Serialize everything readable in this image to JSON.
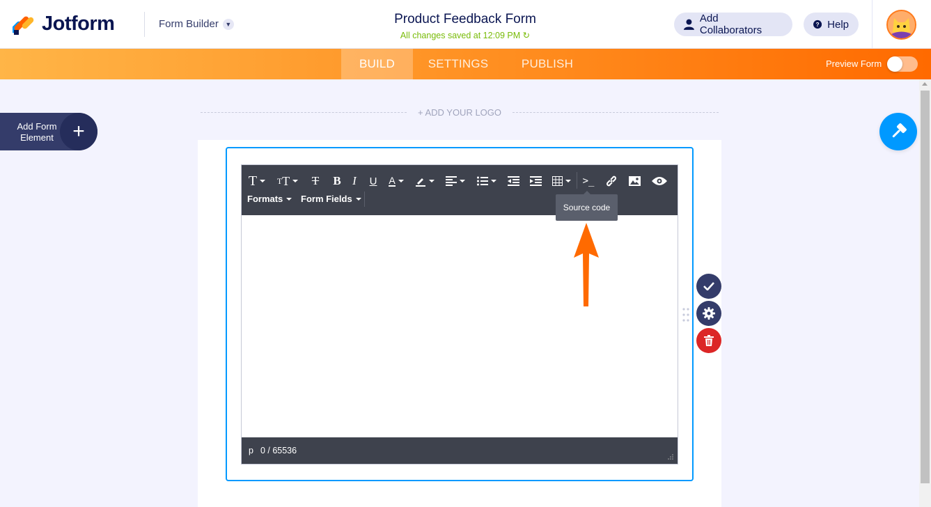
{
  "header": {
    "brand": "Jotform",
    "builder_label": "Form Builder",
    "form_title": "Product Feedback Form",
    "saved_status": "All changes saved at 12:09 PM",
    "collaborators_label": "Add Collaborators",
    "help_label": "Help"
  },
  "nav": {
    "tabs": [
      {
        "label": "BUILD",
        "active": true
      },
      {
        "label": "SETTINGS",
        "active": false
      },
      {
        "label": "PUBLISH",
        "active": false
      }
    ],
    "preview_label": "Preview Form",
    "preview_on": false
  },
  "sidebar": {
    "add_element_label": "Add Form Element"
  },
  "canvas": {
    "add_logo_label": "+ ADD YOUR LOGO"
  },
  "editor": {
    "toolbar_row2": [
      "Formats",
      "Form Fields"
    ],
    "tooltip": "Source code",
    "status_tag": "p",
    "char_count": "0 / 65536"
  },
  "colors": {
    "brand_navy": "#0a1551",
    "orange_start": "#ffb547",
    "orange_end": "#ff6a00",
    "selection_blue": "#0099ff",
    "saved_green": "#78bb07",
    "delete_red": "#dc2626",
    "annotation_arrow": "#ff6a00"
  }
}
